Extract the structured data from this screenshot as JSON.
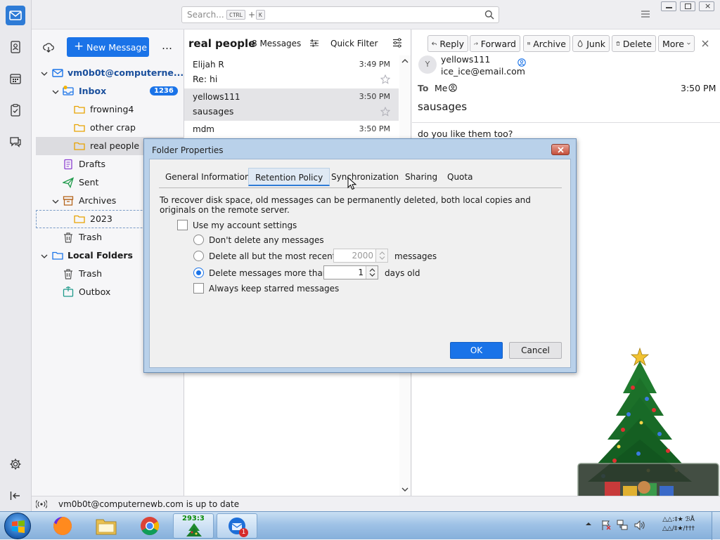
{
  "search": {
    "placeholder": "Search...",
    "key1": "CTRL",
    "plus": "+",
    "key2": "K"
  },
  "folder_pane": {
    "new_message": "New Message",
    "more": "…",
    "account": "vm0b0t@computerne...",
    "folders": [
      {
        "label": "Inbox",
        "count": "1236"
      },
      {
        "label": "frowning4"
      },
      {
        "label": "other crap"
      },
      {
        "label": "real people"
      },
      {
        "label": "Drafts"
      },
      {
        "label": "Sent"
      },
      {
        "label": "Archives"
      },
      {
        "label": "2023"
      },
      {
        "label": "Trash"
      }
    ],
    "local_folders": "Local Folders",
    "local": [
      {
        "label": "Trash"
      },
      {
        "label": "Outbox"
      }
    ]
  },
  "thread_pane": {
    "folder_name": "real people",
    "count": "8 Messages",
    "quick_filter": "Quick Filter",
    "messages": [
      {
        "from": "Elijah R",
        "time": "3:49 PM",
        "subject": "Re: hi"
      },
      {
        "from": "yellows111",
        "time": "3:50 PM",
        "subject": "sausages"
      },
      {
        "from": "mdm",
        "time": "3:50 PM",
        "subject": ""
      }
    ]
  },
  "message_pane": {
    "buttons": {
      "reply": "Reply",
      "forward": "Forward",
      "archive": "Archive",
      "junk": "Junk",
      "delete": "Delete",
      "more": "More"
    },
    "avatar_letter": "Y",
    "from_name": "yellows111",
    "from_email": "ice_ice@email.com",
    "to_label": "To",
    "to_value": "Me",
    "time": "3:50 PM",
    "subject": "sausages",
    "body": "do you like them too?"
  },
  "status_bar": {
    "text": "vm0b0t@computernewb.com is up to date"
  },
  "taskbar": {
    "clock_line1": "△△:‡★ ℬÅ",
    "clock_line2": "△△/‡★/†††",
    "tree_badge": "293:3",
    "thunderbird_badge": "1"
  },
  "dialog": {
    "title": "Folder Properties",
    "tabs": [
      "General Information",
      "Retention Policy",
      "Synchronization",
      "Sharing",
      "Quota"
    ],
    "active_tab": 1,
    "description": "To recover disk space, old messages can be permanently deleted, both local copies and originals on the remote server.",
    "use_account_settings": "Use my account settings",
    "options": {
      "dont_delete": "Don't delete any messages",
      "delete_all_but": "Delete all but the most recent",
      "delete_all_but_value": "2000",
      "delete_all_but_unit": "messages",
      "delete_older": "Delete messages more than",
      "delete_older_value": "1",
      "delete_older_unit": "days old",
      "keep_starred": "Always keep starred messages"
    },
    "ok": "OK",
    "cancel": "Cancel"
  },
  "colors": {
    "accent": "#1a73e8",
    "dialog_frame": "#b9d1ea",
    "selected_row": "#dcdce0"
  }
}
